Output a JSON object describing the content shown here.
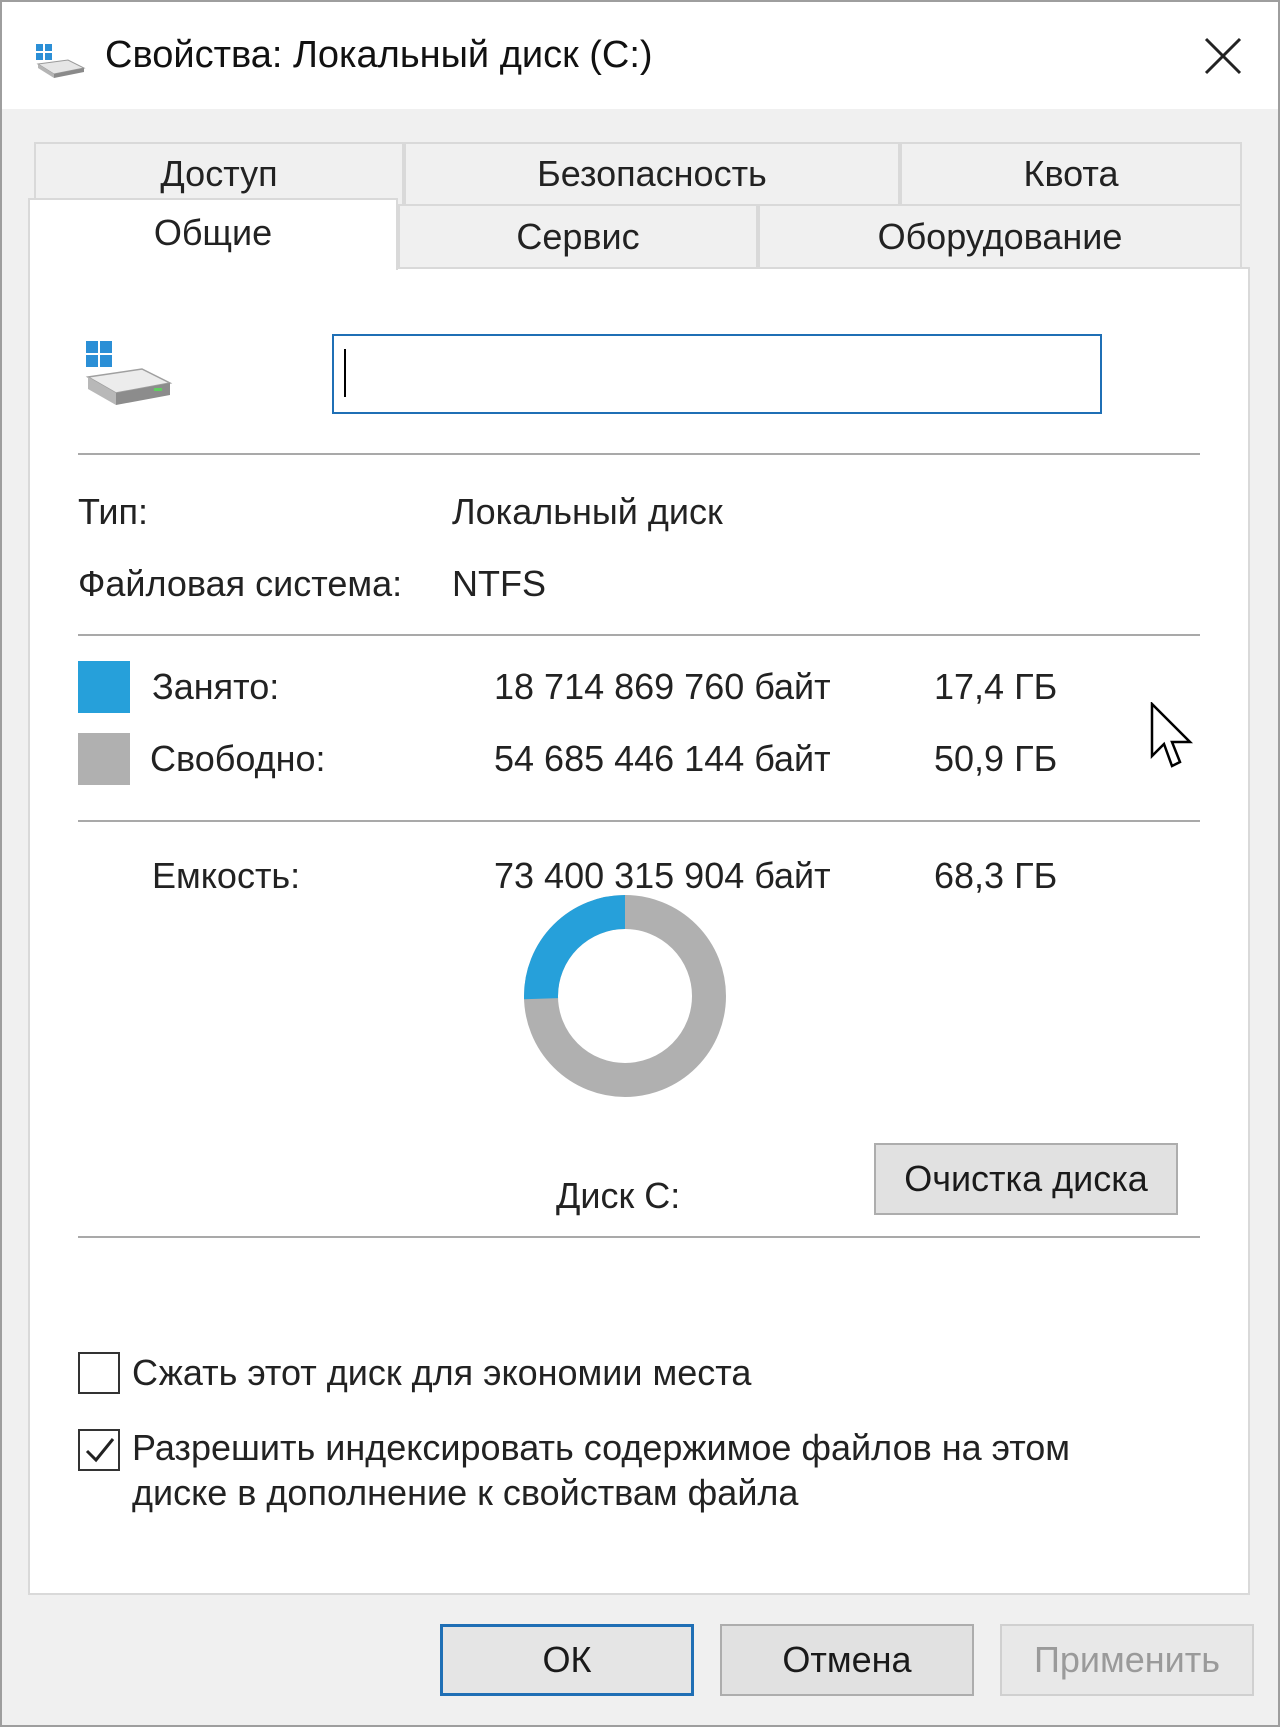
{
  "window": {
    "title": "Свойства: Локальный диск (C:)"
  },
  "tabs": {
    "row1": [
      {
        "label": "Доступ"
      },
      {
        "label": "Безопасность"
      },
      {
        "label": "Квота"
      }
    ],
    "row2": [
      {
        "label": "Общие",
        "active": true
      },
      {
        "label": "Сервис"
      },
      {
        "label": "Оборудование"
      }
    ]
  },
  "general": {
    "name_value": "",
    "type_label": "Тип:",
    "type_value": "Локальный диск",
    "fs_label": "Файловая система:",
    "fs_value": "NTFS",
    "used_label": "Занято:",
    "used_bytes": "18 714 869 760 байт",
    "used_size": "17,4 ГБ",
    "free_label": "Свободно:",
    "free_bytes": "54 685 446 144 байт",
    "free_size": "50,9 ГБ",
    "capacity_label": "Емкость:",
    "capacity_bytes": "73 400 315 904 байт",
    "capacity_size": "68,3 ГБ",
    "drive_label": "Диск C:",
    "cleanup_button": "Очистка диска",
    "compress_label": "Сжать этот диск для экономии места",
    "compress_checked": false,
    "index_label_line1": "Разрешить индексировать содержимое файлов на этом",
    "index_label_line2": "диске в дополнение к свойствам файла",
    "index_checked": true
  },
  "usage": {
    "used_fraction": 0.255,
    "used_color": "#26a0da",
    "free_color": "#b0b0b0"
  },
  "footer": {
    "ok": "ОК",
    "cancel": "Отмена",
    "apply": "Применить"
  }
}
